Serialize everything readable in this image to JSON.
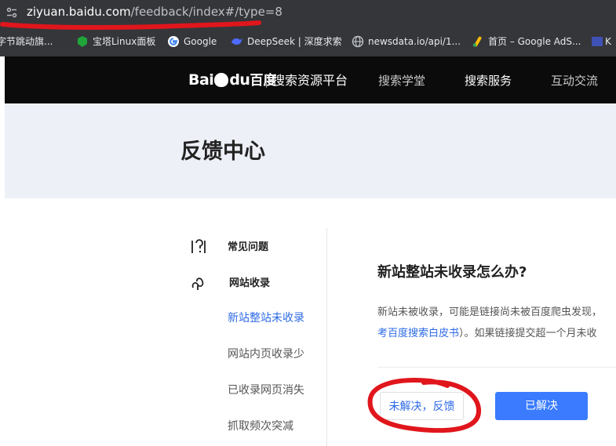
{
  "browser": {
    "url_host": "ziyuan.baidu.com",
    "url_path": "/feedback/index#/type=8",
    "bookmarks": [
      {
        "label": "字节跳动旗...",
        "icon": "bytedance-icon"
      },
      {
        "label": "宝塔Linux面板",
        "icon": "baota-icon"
      },
      {
        "label": "Google",
        "icon": "google-icon"
      },
      {
        "label": "DeepSeek | 深度求索",
        "icon": "deepseek-icon"
      },
      {
        "label": "newsdata.io/api/1...",
        "icon": "globe-icon"
      },
      {
        "label": "首页 – Google AdS...",
        "icon": "google-ads-icon"
      },
      {
        "label": "K",
        "icon": "k-icon"
      }
    ]
  },
  "header": {
    "logo_text": "Bai",
    "logo_text2": "du",
    "logo_cn": "百度",
    "platform": "搜索资源平台",
    "nav": [
      "搜索学堂",
      "搜索服务",
      "互动交流"
    ],
    "active_nav": "搜索服务"
  },
  "banner": {
    "title": "反馈中心"
  },
  "sidebar": {
    "categories": [
      {
        "label": "常见问题",
        "icon": "faq-icon"
      },
      {
        "label": "网站收录",
        "icon": "site-index-icon"
      }
    ],
    "items": [
      "新站整站未收录",
      "网站内页收录少",
      "已收录网页消失",
      "抓取频次突减"
    ],
    "active_item": "新站整站未收录"
  },
  "article": {
    "title": "新站整站未收录怎么办?",
    "line1": "新站未被收录，可能是链接尚未被百度爬虫发现，",
    "line2_link": "考百度搜索白皮书",
    "line2_rest": "）。如果链接提交超一个月未收"
  },
  "actions": {
    "unresolved": "未解决，反馈",
    "resolved": "已解决"
  },
  "colors": {
    "accent": "#2e6be6",
    "primary_button": "#3a7bff",
    "annotation_red": "#e0161c"
  }
}
